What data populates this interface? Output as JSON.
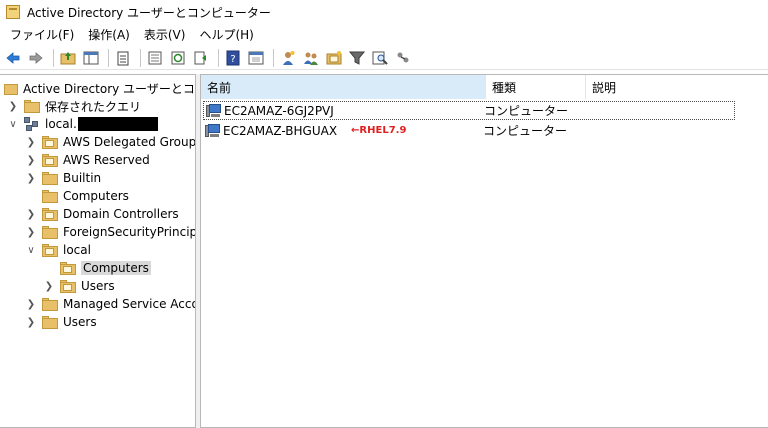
{
  "window": {
    "title": "Active Directory ユーザーとコンピューター"
  },
  "menu": [
    "ファイル(F)",
    "操作(A)",
    "表示(V)",
    "ヘルプ(H)"
  ],
  "tree": {
    "root": "Active Directory ユーザーとコンピュ-",
    "saved_queries": "保存されたクエリ",
    "domain_prefix": "local.",
    "ous": [
      "AWS Delegated Groups",
      "AWS Reserved",
      "Builtin",
      "Computers",
      "Domain Controllers",
      "ForeignSecurityPrincipals",
      "local"
    ],
    "local_children": [
      "Computers",
      "Users"
    ],
    "after_local": [
      "Managed Service Accou",
      "Users"
    ]
  },
  "list": {
    "columns": [
      "名前",
      "種類",
      "説明"
    ],
    "rows": [
      {
        "name": "EC2AMAZ-6GJ2PVJ",
        "type": "コンピューター",
        "note": ""
      },
      {
        "name": "EC2AMAZ-BHGUAX",
        "type": "コンピューター",
        "note": "←RHEL7.9"
      }
    ]
  },
  "colors": {
    "selected_header": "#d9ebf9",
    "annotation": "#e02020"
  },
  "icons": [
    "back-icon",
    "forward-icon",
    "up-folder-icon",
    "show-tree-icon",
    "clipboard-icon",
    "export-list-icon",
    "refresh-icon",
    "move-icon",
    "help-icon",
    "properties-icon",
    "new-user-icon",
    "new-group-icon",
    "new-ou-icon",
    "filter-icon",
    "find-icon",
    "delegate-icon"
  ]
}
